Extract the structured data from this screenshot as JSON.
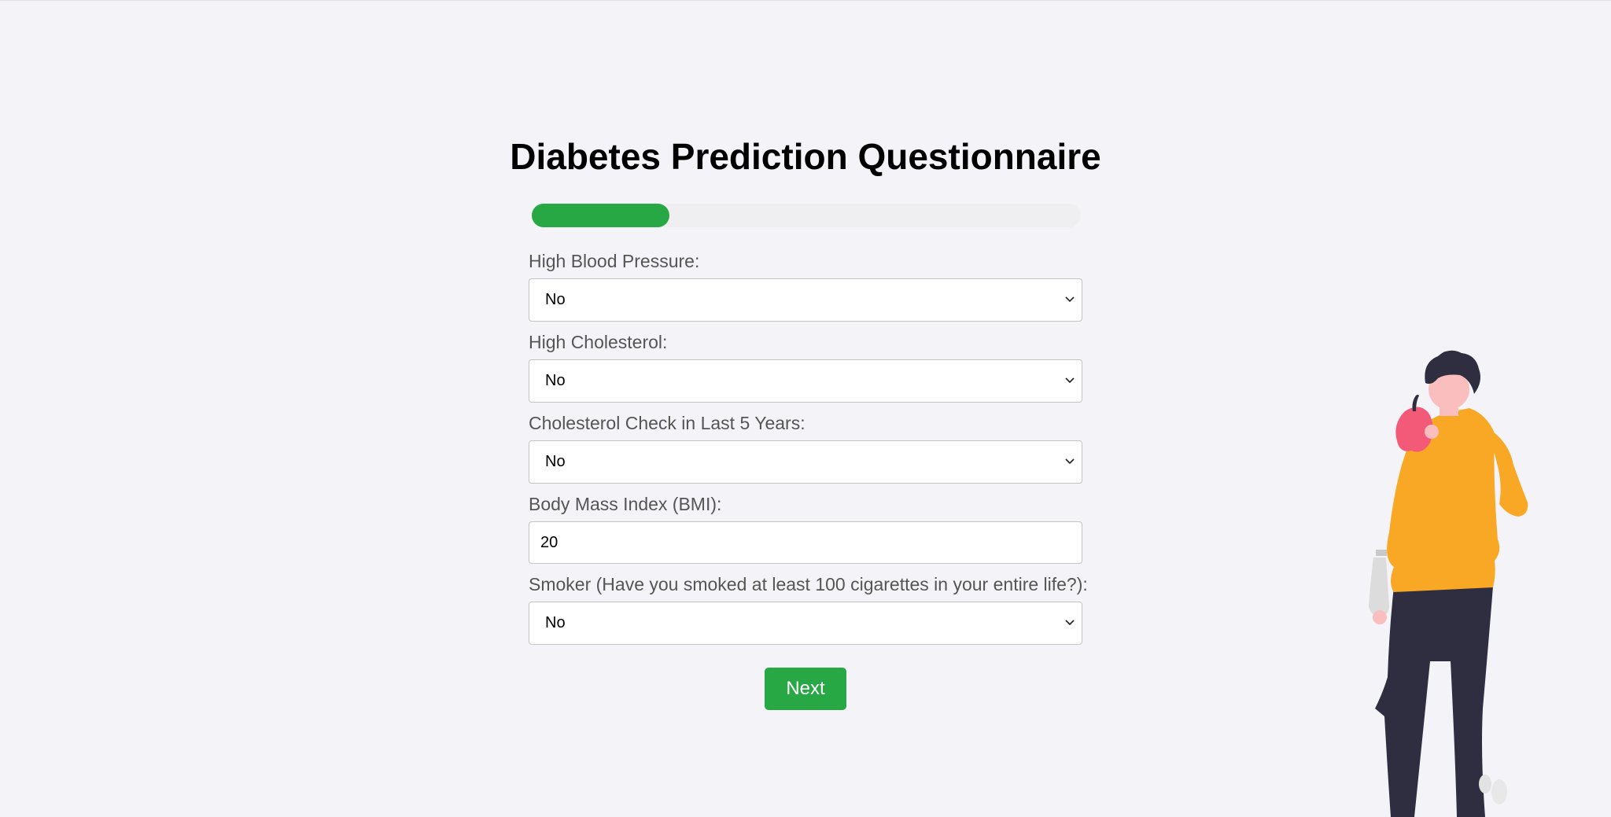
{
  "page": {
    "title": "Diabetes Prediction Questionnaire"
  },
  "progress": {
    "percent": 25,
    "color": "#28a745"
  },
  "fields": [
    {
      "label": "High Blood Pressure:",
      "type": "select",
      "value": "No"
    },
    {
      "label": "High Cholesterol:",
      "type": "select",
      "value": "No"
    },
    {
      "label": "Cholesterol Check in Last 5 Years:",
      "type": "select",
      "value": "No"
    },
    {
      "label": "Body Mass Index (BMI):",
      "type": "input",
      "value": "20"
    },
    {
      "label": "Smoker (Have you smoked at least 100 cigarettes in your entire life?):",
      "type": "select",
      "value": "No"
    }
  ],
  "actions": {
    "next_label": "Next"
  },
  "illustration": {
    "icon": "person-eating-apple-illustration"
  }
}
